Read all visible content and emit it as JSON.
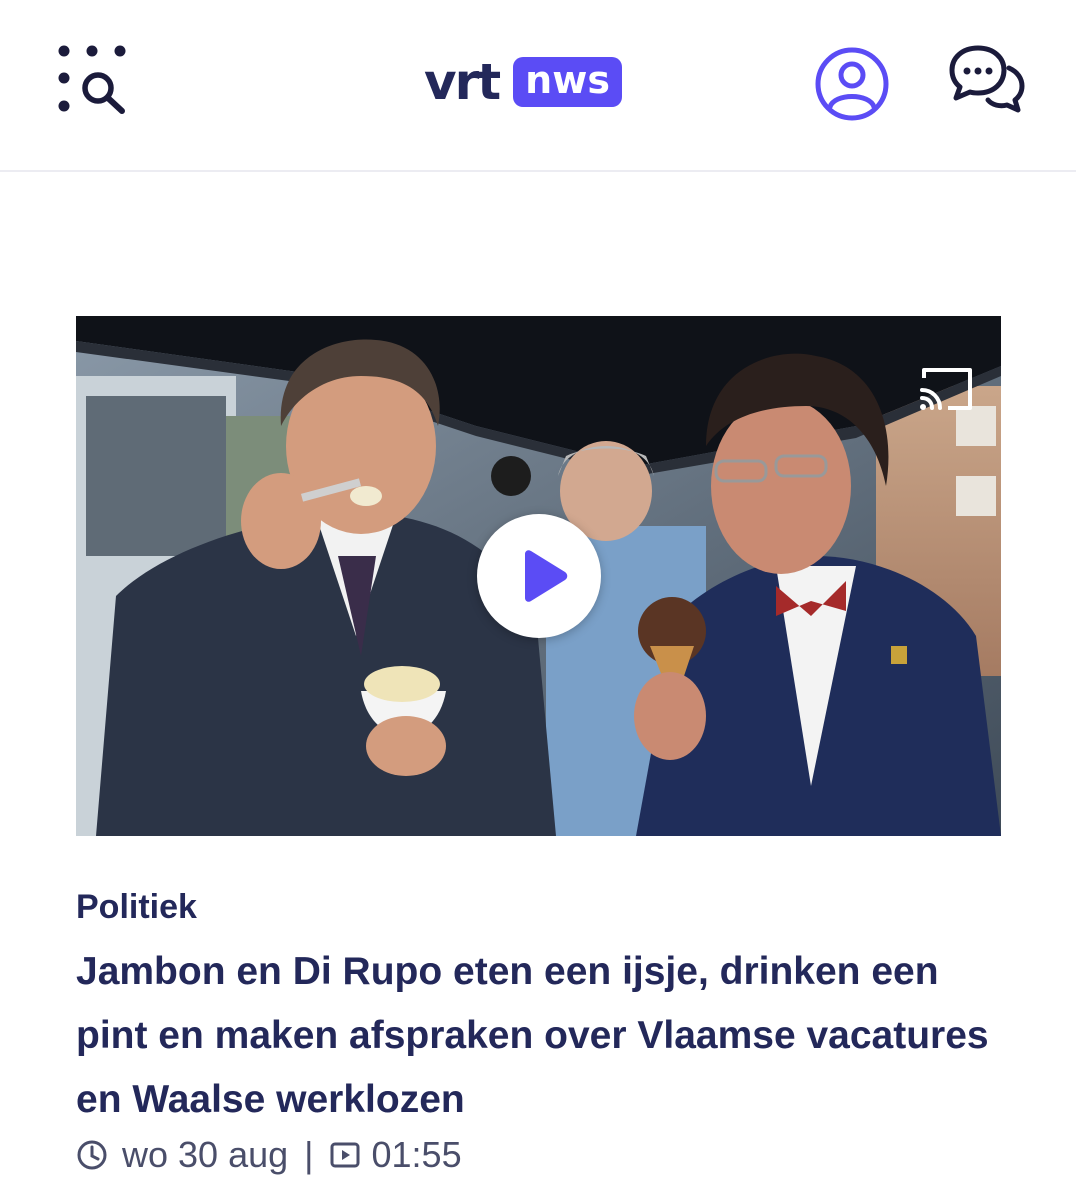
{
  "header": {
    "logo_vrt": "vrt",
    "logo_nws": "nws",
    "brand_color": "#5b4cf5",
    "icons": [
      "menu-search-icon",
      "profile-icon",
      "chat-icon"
    ]
  },
  "video": {
    "icons": [
      "cast-icon",
      "play-icon"
    ]
  },
  "article": {
    "category": "Politiek",
    "title": "Jambon en Di Rupo eten een ijsje, drinken een pint en maken afspraken over Vlaamse vacatures en Waalse werklozen",
    "date": "wo 30 aug",
    "separator": "|",
    "duration": "01:55"
  },
  "colors": {
    "headline": "#23285a",
    "meta": "#4a4e6a",
    "accent": "#5b4cf5"
  }
}
